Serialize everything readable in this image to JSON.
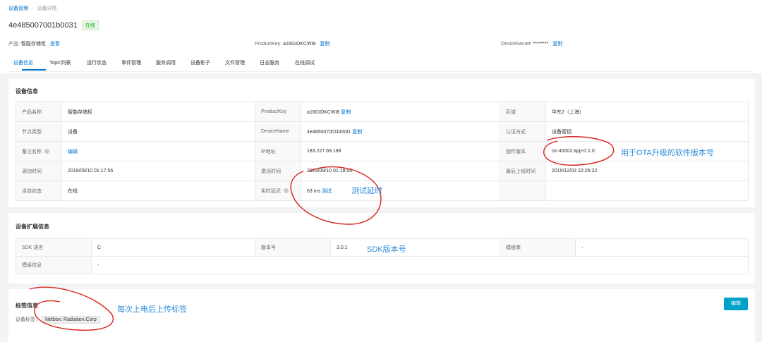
{
  "breadcrumb": {
    "root": "设备管理",
    "current": "设备详情"
  },
  "device": {
    "name": "4e485007001b0031",
    "status": "在线"
  },
  "meta": {
    "product_label": "产品:",
    "product_value": "智能存储柜",
    "view_link": "查看",
    "productkey_label": "ProductKey:",
    "productkey_value": "a16GIDKCWI8",
    "copy": "复制",
    "secret_label": "DeviceSecret:",
    "secret_value": "********"
  },
  "tabs": [
    "设备信息",
    "Topic列表",
    "运行状态",
    "事件管理",
    "服务调用",
    "设备影子",
    "文件管理",
    "日志服务",
    "在线调试"
  ],
  "device_info": {
    "title": "设备信息",
    "rows": [
      [
        {
          "k": "产品名称",
          "v": "智能存储柜"
        },
        {
          "k": "ProductKey",
          "v": "a16GIDKCWI8",
          "link": "复制"
        },
        {
          "k": "区域",
          "v": "华东2（上海）"
        }
      ],
      [
        {
          "k": "节点类型",
          "v": "设备"
        },
        {
          "k": "DeviceName",
          "v": "4e485007001b0031",
          "link": "复制"
        },
        {
          "k": "认证方式",
          "v": "设备密钥"
        }
      ],
      [
        {
          "k": "备注名称",
          "v": "",
          "link": "编辑",
          "info": true
        },
        {
          "k": "IP地址",
          "v": "183.227.69.188"
        },
        {
          "k": "固件版本",
          "v": "os-40002:app-0.1.0"
        }
      ],
      [
        {
          "k": "添加时间",
          "v": "2019/09/10 01:17:56"
        },
        {
          "k": "激活时间",
          "v": "2019/09/10 01:18:00"
        },
        {
          "k": "最后上线时间",
          "v": "2019/12/03 22:26:22"
        }
      ],
      [
        {
          "k": "当前状态",
          "v": "在线"
        },
        {
          "k": "实时延迟",
          "v": "63 ms",
          "link": "测试",
          "info": true
        },
        {
          "k": "",
          "v": ""
        }
      ]
    ]
  },
  "ext_info": {
    "title": "设备扩展信息",
    "rows": [
      [
        {
          "k": "SDK 语言",
          "v": "C"
        },
        {
          "k": "版本号",
          "v": "3.0.1"
        },
        {
          "k": "模组商",
          "v": "-"
        }
      ],
      [
        {
          "k": "模组信息",
          "v": "-"
        }
      ]
    ]
  },
  "tag_info": {
    "title": "标签信息",
    "label": "设备标签：",
    "tag": "Netbox: Radiation.Corp",
    "edit": "编辑"
  },
  "annotations": {
    "firmware": "用于OTA升级的软件版本号",
    "latency": "测试延时",
    "sdk": "SDK版本号",
    "tags": "每次上电后上传标签"
  }
}
